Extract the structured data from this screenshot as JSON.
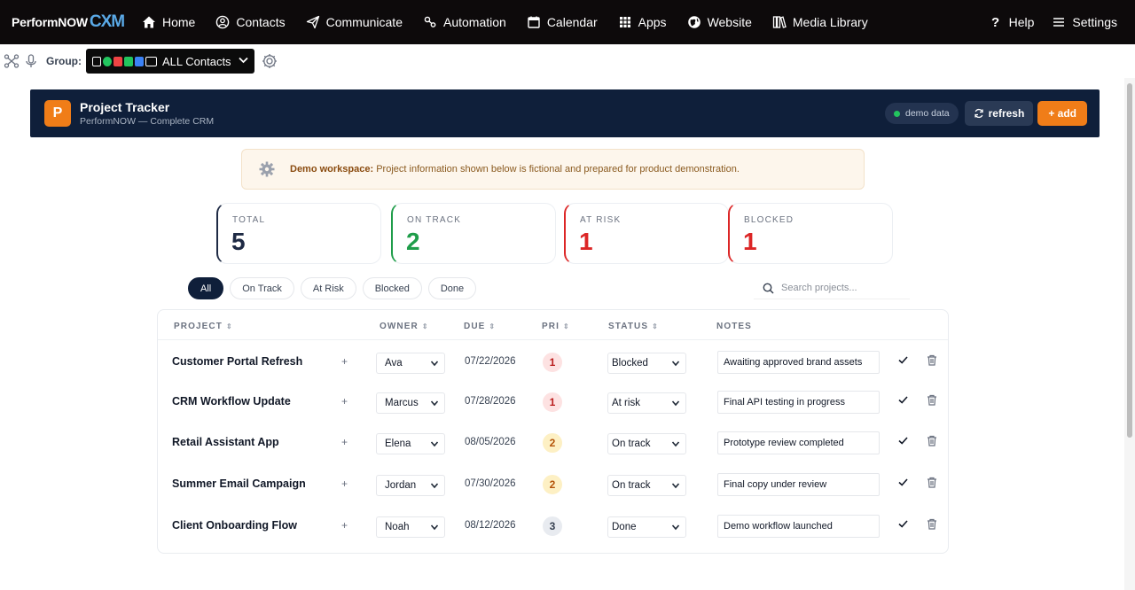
{
  "nav": {
    "brand": "PerformNOW",
    "brand_suffix": "CXM",
    "items": [
      {
        "label": "Home",
        "icon": "home-icon"
      },
      {
        "label": "Contacts",
        "icon": "contacts-icon"
      },
      {
        "label": "Communicate",
        "icon": "send-icon"
      },
      {
        "label": "Automation",
        "icon": "automation-icon"
      },
      {
        "label": "Calendar",
        "icon": "calendar-icon"
      },
      {
        "label": "Apps",
        "icon": "apps-grid-icon"
      },
      {
        "label": "Website",
        "icon": "globe-icon"
      },
      {
        "label": "Media Library",
        "icon": "media-library-icon"
      }
    ],
    "right": [
      {
        "label": "Help",
        "icon": "question-icon"
      },
      {
        "label": "Settings",
        "icon": "menu-icon"
      }
    ]
  },
  "groupbar": {
    "label": "Group:",
    "selected": "ALL Contacts",
    "badge_colors": [
      "#ffffff",
      "#22c55e",
      "#ef4444",
      "#22c55e",
      "#3b82f6",
      "#ffffff"
    ]
  },
  "header": {
    "logo_letter": "P",
    "title": "Project Tracker",
    "subtitle": "PerformNOW — Complete CRM",
    "demo_pill": "demo data",
    "refresh_label": "refresh",
    "add_label": "+ add"
  },
  "banner": {
    "strong": "Demo workspace:",
    "text": " Project information shown below is fictional and prepared for product demonstration."
  },
  "stats": [
    {
      "label": "TOTAL",
      "value": "5",
      "color": "#1e2a44"
    },
    {
      "label": "ON TRACK",
      "value": "2",
      "color": "#1f9d4a"
    },
    {
      "label": "AT RISK",
      "value": "1",
      "color": "#dc2626"
    },
    {
      "label": "BLOCKED",
      "value": "1",
      "color": "#dc2626"
    }
  ],
  "filters": [
    "All",
    "On Track",
    "At Risk",
    "Blocked",
    "Done"
  ],
  "active_filter": "All",
  "search": {
    "placeholder": "Search projects..."
  },
  "table": {
    "headers": {
      "project": "PROJECT",
      "owner": "OWNER",
      "due": "DUE",
      "pri": "PRI",
      "status": "STATUS",
      "notes": "NOTES"
    },
    "rows": [
      {
        "project": "Customer Portal Refresh",
        "owner": "Ava",
        "due": "07/22/2026",
        "pri": "1",
        "status": "Blocked",
        "note": "Awaiting approved brand assets"
      },
      {
        "project": "CRM Workflow Update",
        "owner": "Marcus",
        "due": "07/28/2026",
        "pri": "1",
        "status": "At risk",
        "note": "Final API testing in progress"
      },
      {
        "project": "Retail Assistant App",
        "owner": "Elena",
        "due": "08/05/2026",
        "pri": "2",
        "status": "On track",
        "note": "Prototype review completed"
      },
      {
        "project": "Summer Email Campaign",
        "owner": "Jordan",
        "due": "07/30/2026",
        "pri": "2",
        "status": "On track",
        "note": "Final copy under review"
      },
      {
        "project": "Client Onboarding Flow",
        "owner": "Noah",
        "due": "08/12/2026",
        "pri": "3",
        "status": "Done",
        "note": "Demo workflow launched"
      }
    ]
  },
  "pri_colors": {
    "1": {
      "bg": "#fde2e2",
      "fg": "#b91c1c"
    },
    "2": {
      "bg": "#fdf0c4",
      "fg": "#b45309"
    },
    "3": {
      "bg": "#e8ebf0",
      "fg": "#374151"
    }
  }
}
